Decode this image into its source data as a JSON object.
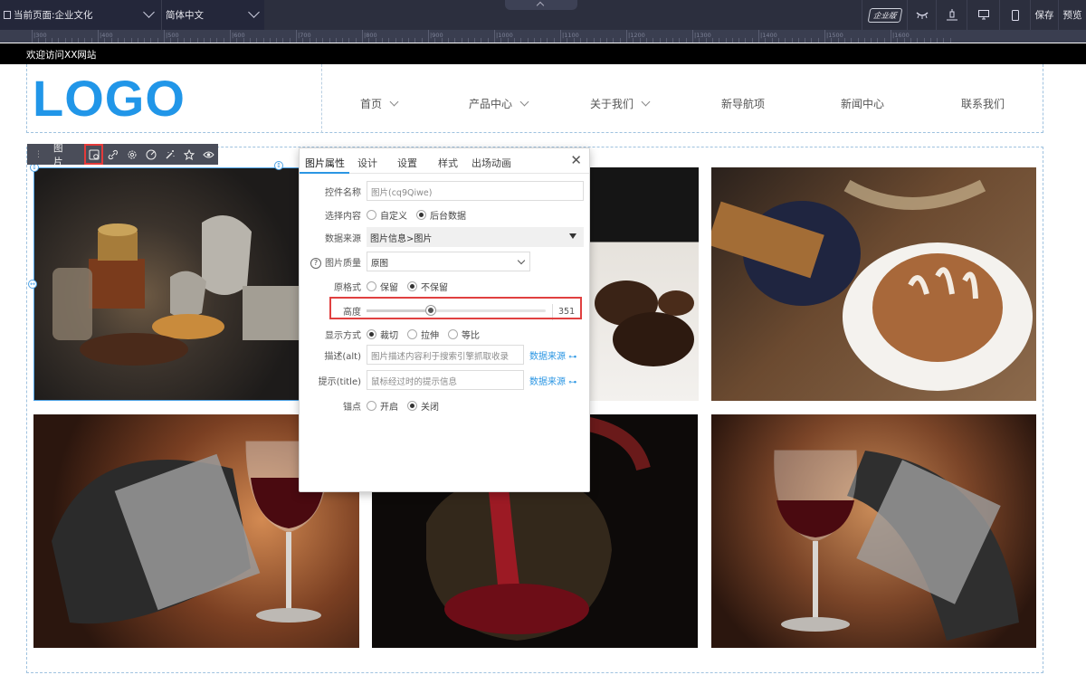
{
  "topbar": {
    "current_page": "当前页面:企业文化",
    "language": "简体中文",
    "edition_badge": "企业版",
    "save_label": "保存",
    "preview_label": "预览"
  },
  "ruler": {
    "marks": [
      "|300",
      "|400",
      "|500",
      "|600",
      "|700",
      "|800",
      "|900",
      "|1000",
      "|1100",
      "|1200",
      "|1300",
      "|1400",
      "|1500",
      "|1600"
    ]
  },
  "site": {
    "welcome": "欢迎访问XX网站",
    "logo": "LOGO",
    "nav": [
      {
        "label": "首页",
        "active": true,
        "has_dropdown": true
      },
      {
        "label": "产品中心",
        "active": false,
        "has_dropdown": true
      },
      {
        "label": "关于我们",
        "active": false,
        "has_dropdown": true
      },
      {
        "label": "新导航项",
        "active": false,
        "has_dropdown": false
      },
      {
        "label": "新闻中心",
        "active": false,
        "has_dropdown": false
      },
      {
        "label": "联系我们",
        "active": false,
        "has_dropdown": false
      }
    ]
  },
  "image_toolbar": {
    "label": "图片",
    "icons": [
      "image-settings-icon",
      "link-icon",
      "gear-icon",
      "palette-icon",
      "magic-wand-icon",
      "star-icon",
      "eye-icon"
    ]
  },
  "dialog": {
    "tabs": [
      "图片属性",
      "设计",
      "设置",
      "样式",
      "出场动画"
    ],
    "active_tab": "图片属性",
    "fields": {
      "control_name": {
        "label": "控件名称",
        "value": "图片(cq9Qiwe)"
      },
      "content": {
        "label": "选择内容",
        "options": [
          "自定义",
          "后台数据"
        ],
        "selected": "后台数据"
      },
      "data_source": {
        "label": "数据来源",
        "value": "图片信息>图片"
      },
      "quality": {
        "label": "图片质量",
        "value": "原图"
      },
      "original_format": {
        "label": "原格式",
        "options": [
          "保留",
          "不保留"
        ],
        "selected": "不保留"
      },
      "height": {
        "label": "高度",
        "value": "351",
        "slider_fraction": 0.36
      },
      "display_mode": {
        "label": "显示方式",
        "options": [
          "裁切",
          "拉伸",
          "等比"
        ],
        "selected": "裁切"
      },
      "alt": {
        "label": "描述(alt)",
        "placeholder": "图片描述内容利于搜索引擎抓取收录",
        "link": "数据来源"
      },
      "title": {
        "label": "提示(title)",
        "placeholder": "鼠标经过时的提示信息",
        "link": "数据来源"
      },
      "anchor": {
        "label": "锚点",
        "options": [
          "开启",
          "关闭"
        ],
        "selected": "关闭"
      }
    }
  },
  "colors": {
    "accent": "#2b96e3",
    "highlight": "#e04040",
    "toolbar_bg": "#2c2f3e"
  }
}
